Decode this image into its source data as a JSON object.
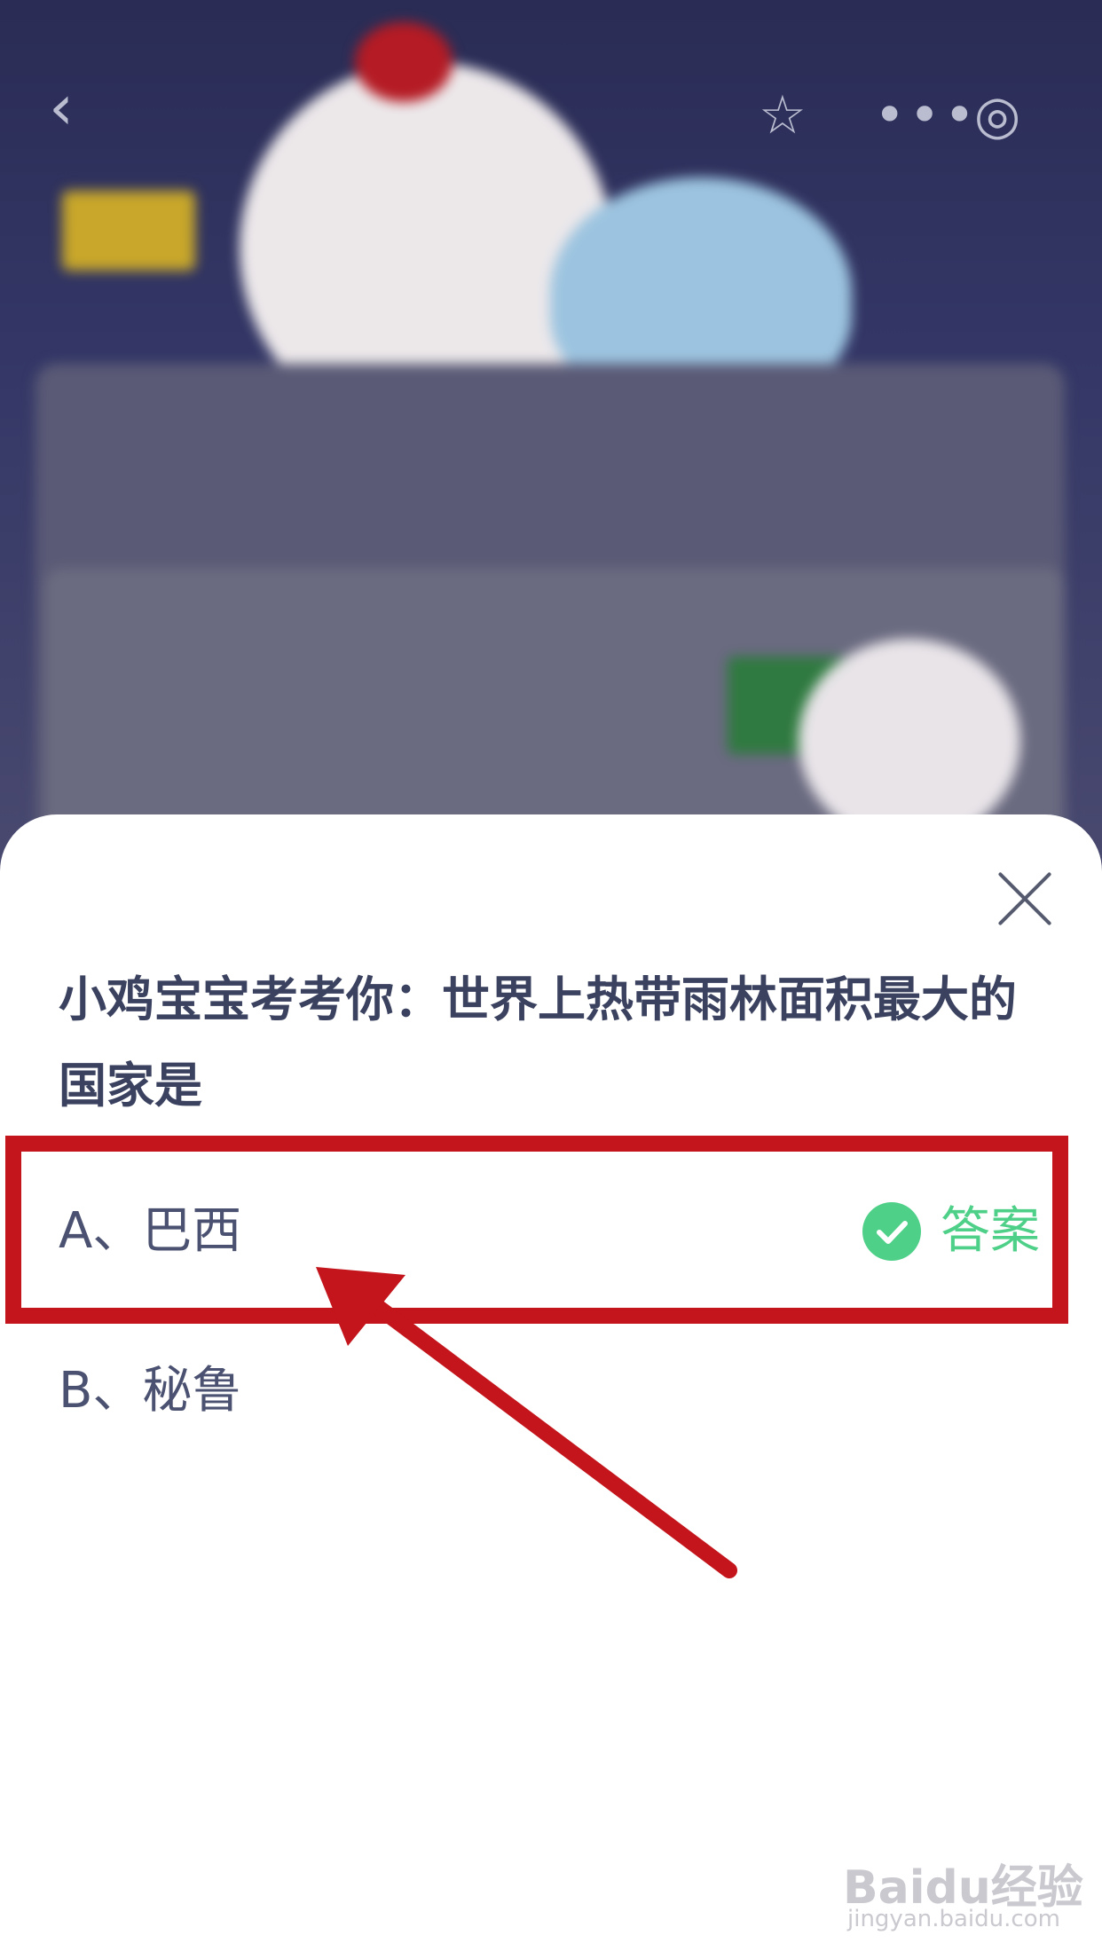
{
  "quiz": {
    "question": "小鸡宝宝考考你：世界上热带雨林面积最大的国家是",
    "options": [
      {
        "label": "A、巴西",
        "is_answer": true,
        "answer_label": "答案"
      },
      {
        "label": "B、秘鲁",
        "is_answer": false
      }
    ]
  },
  "watermark": {
    "logo": "Baidu经验",
    "url": "jingyan.baidu.com"
  },
  "colors": {
    "accent_green": "#4fd089",
    "highlight_red": "#c3151b",
    "question_text": "#3b4260",
    "bg_dark": "#26284a"
  },
  "icons": [
    "back-icon",
    "star-icon",
    "more-icon",
    "target-icon",
    "close-icon",
    "check-icon"
  ]
}
